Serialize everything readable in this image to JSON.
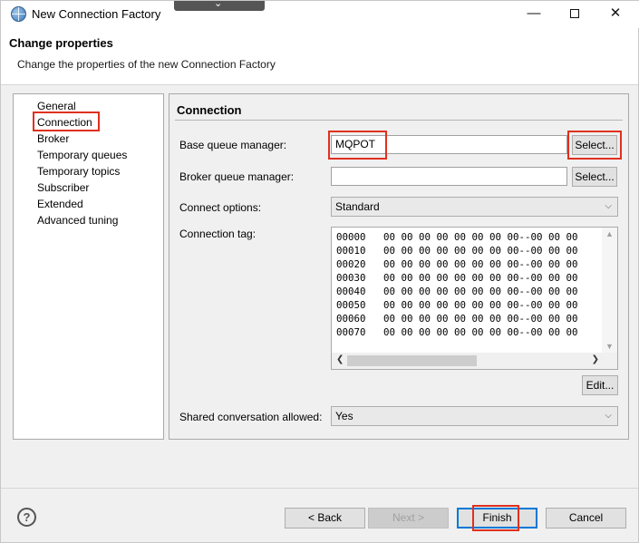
{
  "window": {
    "title": "New Connection Factory",
    "overlay_chevron": "⌄",
    "minimize_symbol": "—",
    "close_symbol": "✕"
  },
  "header": {
    "title": "Change properties",
    "description": "Change the properties of the new Connection Factory"
  },
  "nav": {
    "items": [
      {
        "label": "General"
      },
      {
        "label": "Connection",
        "selected": true
      },
      {
        "label": "Broker"
      },
      {
        "label": "Temporary queues"
      },
      {
        "label": "Temporary topics"
      },
      {
        "label": "Subscriber"
      },
      {
        "label": "Extended"
      },
      {
        "label": "Advanced tuning"
      }
    ]
  },
  "panel": {
    "title": "Connection",
    "base_qm": {
      "label": "Base queue manager:",
      "value": "MQPOT",
      "button": "Select..."
    },
    "broker_qm": {
      "label": "Broker queue manager:",
      "value": "",
      "button": "Select..."
    },
    "connect_options": {
      "label": "Connect options:",
      "value": "Standard"
    },
    "connection_tag": {
      "label": "Connection tag:",
      "lines": [
        "00000   00 00 00 00 00 00 00 00--00 00 00",
        "00010   00 00 00 00 00 00 00 00--00 00 00",
        "00020   00 00 00 00 00 00 00 00--00 00 00",
        "00030   00 00 00 00 00 00 00 00--00 00 00",
        "00040   00 00 00 00 00 00 00 00--00 00 00",
        "00050   00 00 00 00 00 00 00 00--00 00 00",
        "00060   00 00 00 00 00 00 00 00--00 00 00",
        "00070   00 00 00 00 00 00 00 00--00 00 00"
      ],
      "edit_button": "Edit..."
    },
    "shared_conversation": {
      "label": "Shared conversation allowed:",
      "value": "Yes"
    }
  },
  "footer": {
    "help": "?",
    "back": "< Back",
    "next": "Next >",
    "finish": "Finish",
    "cancel": "Cancel"
  },
  "colors": {
    "highlight": "#e0301e",
    "default_button_border": "#0078d7"
  },
  "icons": [
    "app-globe-icon",
    "help-icon",
    "chevron-down-icon",
    "scroll-arrow-icon"
  ]
}
